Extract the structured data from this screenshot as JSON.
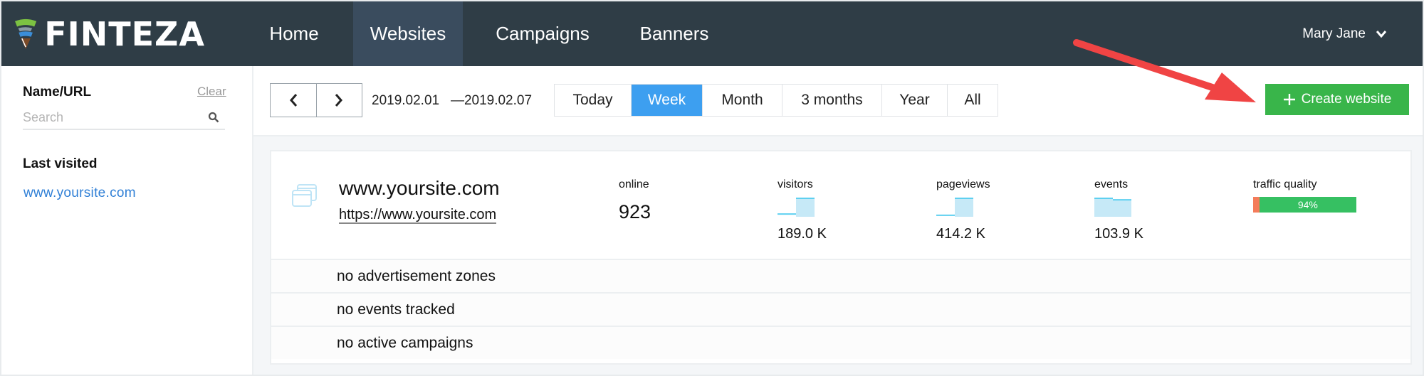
{
  "header": {
    "brand": "FINTEZA",
    "nav": [
      {
        "label": "Home",
        "active": false
      },
      {
        "label": "Websites",
        "active": true
      },
      {
        "label": "Campaigns",
        "active": false
      },
      {
        "label": "Banners",
        "active": false
      }
    ],
    "user_name": "Mary Jane",
    "colors": {
      "bar": "#2f3d46",
      "active_tab": "#3a4c5e"
    }
  },
  "sidebar": {
    "filter_label": "Name/URL",
    "clear_label": "Clear",
    "search_placeholder": "Search",
    "last_visited_label": "Last visited",
    "last_visited_items": [
      "www.yoursite.com"
    ]
  },
  "toolbar": {
    "prev_icon": "chevron-left-icon",
    "next_icon": "chevron-right-icon",
    "date_from": "2019.02.01",
    "date_to": "—2019.02.07",
    "periods": [
      {
        "label": "Today",
        "selected": false
      },
      {
        "label": "Week",
        "selected": true
      },
      {
        "label": "Month",
        "selected": false
      },
      {
        "label": "3 months",
        "selected": false
      },
      {
        "label": "Year",
        "selected": false
      },
      {
        "label": "All",
        "selected": false
      }
    ],
    "create_label": "Create website",
    "colors": {
      "selected": "#3d9ff0",
      "create": "#39b54a",
      "annotation_arrow": "#f04444"
    }
  },
  "website": {
    "name": "www.yoursite.com",
    "url": "https://www.yoursite.com",
    "online_label": "online",
    "online_value": "923",
    "metrics": [
      {
        "label": "visitors",
        "value": "189.0 K",
        "trend": [
          0.15,
          1.0
        ]
      },
      {
        "label": "pageviews",
        "value": "414.2 K",
        "trend": [
          0.08,
          1.0
        ]
      },
      {
        "label": "events",
        "value": "103.9 K",
        "trend": [
          1.0,
          0.92
        ]
      }
    ],
    "traffic_quality_label": "traffic quality",
    "traffic_quality_percent": 94,
    "traffic_quality_text": "94%",
    "colors": {
      "good": "#36c062",
      "bad": "#f47c5a",
      "spark": "#c6e9f7",
      "spark_line": "#5ed0f0"
    }
  },
  "status_rows": [
    "no advertisement zones",
    "no events tracked",
    "no active campaigns"
  ]
}
